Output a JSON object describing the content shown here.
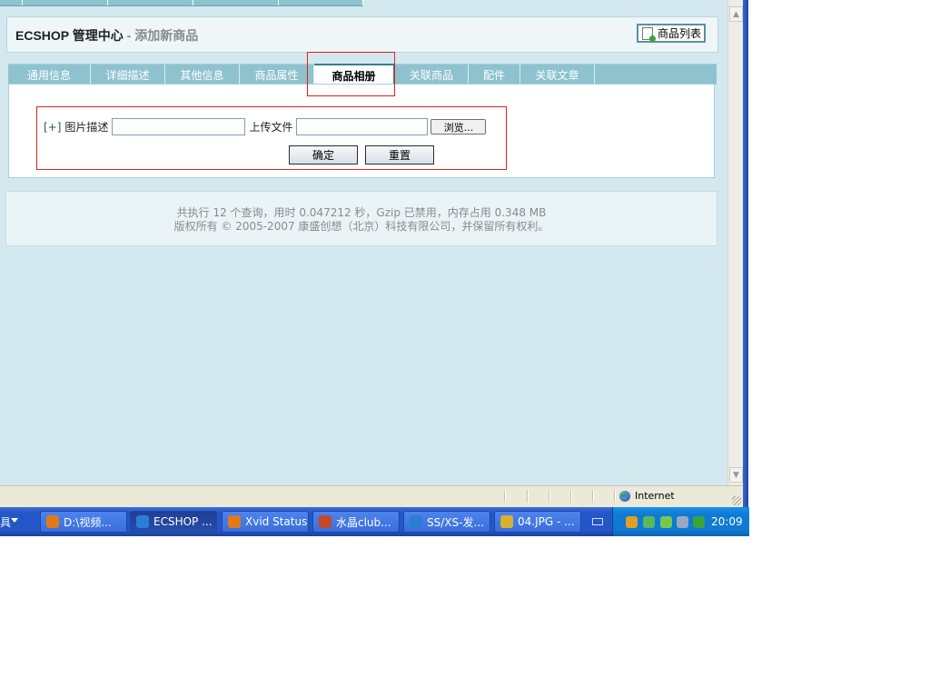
{
  "header": {
    "app_title": "ECSHOP 管理中心",
    "subtitle": " - 添加新商品",
    "goods_list_button": "商品列表"
  },
  "tabs": [
    {
      "label": "通用信息",
      "active": false
    },
    {
      "label": "详细描述",
      "active": false
    },
    {
      "label": "其他信息",
      "active": false
    },
    {
      "label": "商品属性",
      "active": false
    },
    {
      "label": "商品相册",
      "active": true
    },
    {
      "label": "关联商品",
      "active": false
    },
    {
      "label": "配件",
      "active": false
    },
    {
      "label": "关联文章",
      "active": false
    }
  ],
  "gallery_form": {
    "add_link": "[+]",
    "image_desc_label": "图片描述",
    "image_desc_value": "",
    "upload_label": "上传文件",
    "upload_value": "",
    "browse_button": "浏览...",
    "submit_button": "确定",
    "reset_button": "重置"
  },
  "footer": {
    "stats": "共执行 12 个查询，用时 0.047212 秒，Gzip 已禁用，内存占用 0.348 MB",
    "copyright": "版权所有 © 2005-2007 康盛创想（北京）科技有限公司，并保留所有权利。"
  },
  "status_bar": {
    "zone": "Internet"
  },
  "taskbar": {
    "tools_label": "具",
    "tasks": [
      {
        "label": "D:\\视频...",
        "icon": "firefox-icon",
        "color": "#e07a1a",
        "active": false
      },
      {
        "label": "ECSHOP ...",
        "icon": "ie-icon",
        "color": "#2a7fd4",
        "active": true
      },
      {
        "label": "Xvid Status",
        "icon": "xvid-icon",
        "color": "#e07a1a",
        "active": false
      },
      {
        "label": "水晶club...",
        "icon": "house-icon",
        "color": "#c24a2a",
        "active": false
      },
      {
        "label": "SS/XS-发...",
        "icon": "ie-icon",
        "color": "#2a7fd4",
        "active": false
      },
      {
        "label": "04.JPG - ...",
        "icon": "paint-icon",
        "color": "#d9b030",
        "active": false
      }
    ],
    "clock": "20:09"
  }
}
